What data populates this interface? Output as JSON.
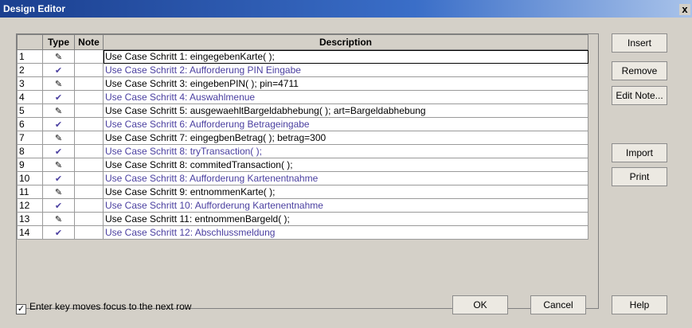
{
  "window": {
    "title": "Design Editor",
    "close_glyph": "x"
  },
  "grid": {
    "headers": {
      "num": "",
      "type": "Type",
      "note": "Note",
      "description": "Description"
    },
    "colors": {
      "normal": "#000000",
      "alt": "#4a3fa0"
    },
    "rows": [
      {
        "num": "1",
        "type": "pencil-icon",
        "type_glyph": "✎",
        "note": "",
        "description": "Use Case Schritt 1: eingegebenKarte( );",
        "style": "normal"
      },
      {
        "num": "2",
        "type": "checkmark-icon",
        "type_glyph": "✔",
        "note": "",
        "description": "Use Case Schritt 2: Aufforderung PIN Eingabe",
        "style": "alt"
      },
      {
        "num": "3",
        "type": "pencil-icon",
        "type_glyph": "✎",
        "note": "",
        "description": "Use Case Schritt 3: eingebenPIN( ); pin=4711",
        "style": "normal"
      },
      {
        "num": "4",
        "type": "checkmark-icon",
        "type_glyph": "✔",
        "note": "",
        "description": "Use Case Schritt 4: Auswahlmenue",
        "style": "alt"
      },
      {
        "num": "5",
        "type": "pencil-icon",
        "type_glyph": "✎",
        "note": "",
        "description": "Use Case Schritt 5: ausgewaehltBargeldabhebung( ); art=Bargeldabhebung",
        "style": "normal"
      },
      {
        "num": "6",
        "type": "checkmark-icon",
        "type_glyph": "✔",
        "note": "",
        "description": "Use Case Schritt 6: Aufforderung Betrageingabe",
        "style": "alt"
      },
      {
        "num": "7",
        "type": "pencil-icon",
        "type_glyph": "✎",
        "note": "",
        "description": "Use Case Schritt 7: eingegbenBetrag( ); betrag=300",
        "style": "normal"
      },
      {
        "num": "8",
        "type": "checkmark-icon",
        "type_glyph": "✔",
        "note": "",
        "description": "Use Case Schritt 8: tryTransaction( );",
        "style": "alt"
      },
      {
        "num": "9",
        "type": "pencil-icon",
        "type_glyph": "✎",
        "note": "",
        "description": "Use Case Schritt 8: commitedTransaction( );",
        "style": "normal"
      },
      {
        "num": "10",
        "type": "checkmark-icon",
        "type_glyph": "✔",
        "note": "",
        "description": "Use Case Schritt 8: Aufforderung Kartenentnahme",
        "style": "alt"
      },
      {
        "num": "11",
        "type": "pencil-icon",
        "type_glyph": "✎",
        "note": "",
        "description": "Use Case Schritt 9: entnommenKarte( );",
        "style": "normal"
      },
      {
        "num": "12",
        "type": "checkmark-icon",
        "type_glyph": "✔",
        "note": "",
        "description": "Use Case Schritt 10: Aufforderung Kartenentnahme",
        "style": "alt"
      },
      {
        "num": "13",
        "type": "pencil-icon",
        "type_glyph": "✎",
        "note": "",
        "description": "Use Case Schritt 11: entnommenBargeld( );",
        "style": "normal"
      },
      {
        "num": "14",
        "type": "checkmark-icon",
        "type_glyph": "✔",
        "note": "",
        "description": "Use Case Schritt 12: Abschlussmeldung",
        "style": "alt"
      }
    ]
  },
  "buttons": {
    "insert": "Insert",
    "remove": "Remove",
    "edit_note": "Edit Note...",
    "import": "Import",
    "print": "Print",
    "ok": "OK",
    "cancel": "Cancel",
    "help": "Help"
  },
  "checkbox": {
    "label": "Enter key moves focus to the next row",
    "checked": true,
    "glyph": "✓"
  }
}
